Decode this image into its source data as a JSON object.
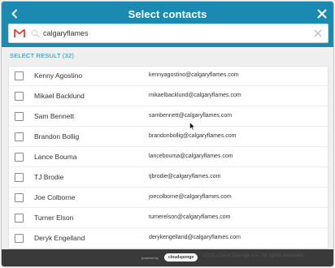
{
  "header": {
    "title": "Select contacts"
  },
  "search": {
    "value": "calgaryflames"
  },
  "results": {
    "label": "SELECT RESULT (32)"
  },
  "contacts": [
    {
      "name": "Kenny Agostino",
      "email": "kennyagostino@calgaryflames.com"
    },
    {
      "name": "Mikael Backlund",
      "email": "mikaelbacklund@calgaryflames.com"
    },
    {
      "name": "Sam Bennett",
      "email": "sambennett@calgaryflames.com"
    },
    {
      "name": "Brandon Bollig",
      "email": "brandonbollig@calgaryflames.com"
    },
    {
      "name": "Lance Bouma",
      "email": "lancebouma@calgaryflames.com"
    },
    {
      "name": "TJ Brodie",
      "email": "tjbrodie@calgaryflames.com"
    },
    {
      "name": "Joe Colborne",
      "email": "joecolborne@calgaryflames.com"
    },
    {
      "name": "Turner Elson",
      "email": "turnerelson@calgaryflames.com"
    },
    {
      "name": "Deryk Engelland",
      "email": "derykengelland@calgaryflames.com"
    }
  ],
  "footer": {
    "powered_by": "powered by",
    "brand": "cloudsponge",
    "copyright": "2015 Cloud Sponge Inc. All rights reserved."
  },
  "colors": {
    "accent": "#1b8ab1",
    "footer": "#3a3a3a",
    "gmail_red": "#d93025"
  },
  "icons": {
    "back": "chevron-left-icon",
    "close": "close-icon",
    "provider": "gmail-icon",
    "search": "search-icon",
    "clear": "clear-icon"
  }
}
